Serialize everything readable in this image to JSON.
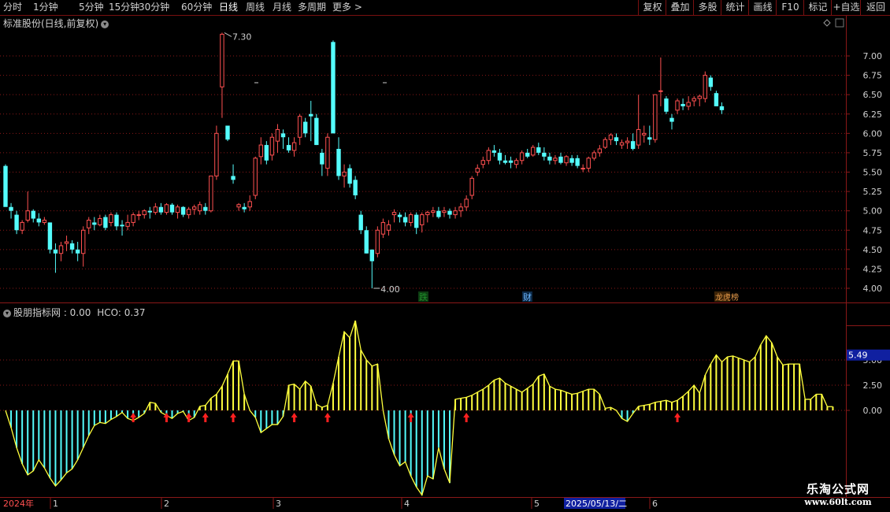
{
  "toolbar": {
    "periods": [
      "分时",
      "1分钟",
      "5分钟",
      "15分钟",
      "30分钟",
      "60分钟",
      "日线",
      "周线",
      "月线",
      "多周期",
      "更多 >"
    ],
    "active": "日线",
    "right_buttons": [
      "复权",
      "叠加",
      "多股",
      "统计",
      "画线",
      "F10",
      "标记",
      "+自选",
      "返回"
    ]
  },
  "price_panel": {
    "title": "标准股份(日线,前复权)",
    "high_label": "7.30",
    "low_label": "4.00",
    "yticks": [
      "7.00",
      "6.75",
      "6.50",
      "6.25",
      "6.00",
      "5.75",
      "5.50",
      "5.25",
      "5.00",
      "4.75",
      "4.50",
      "4.25",
      "4.00"
    ],
    "events": [
      {
        "text": "跌",
        "color": "#1f8f2a",
        "bg": "#0d3d12"
      },
      {
        "text": "财",
        "color": "#6fb8ff",
        "bg": "#0c2a48"
      },
      {
        "text": "龙虎榜",
        "color": "#e59a4a",
        "bg": "#3d2408"
      }
    ]
  },
  "indicator_panel": {
    "title": "股朋指标网 : 0.00",
    "hco_label": "HCO: 0.37",
    "yticks": [
      "5.00",
      "2.50",
      "0.00"
    ],
    "current_value": "5.49"
  },
  "time_axis": {
    "labels": [
      "2024年",
      "1",
      "2",
      "3",
      "4",
      "5",
      "2025/05/13/二",
      "6"
    ]
  },
  "watermark": {
    "line1": "乐淘公式网",
    "line2": "www.60lt.com"
  },
  "colors": {
    "up": "#ff5050",
    "down": "#54fcfc",
    "yellow": "#ffff3c",
    "grid": "#8a1818",
    "arrow": "#ff2020"
  },
  "chart_data": {
    "type": "candlestick",
    "candles": [
      [
        5.58,
        5.6,
        5.3,
        5.05
      ],
      [
        5.05,
        5.1,
        4.9,
        5.0
      ],
      [
        4.95,
        5.0,
        4.7,
        4.75
      ],
      [
        4.75,
        4.88,
        4.7,
        4.85
      ],
      [
        4.88,
        5.25,
        4.85,
        5.0
      ],
      [
        5.0,
        5.02,
        4.85,
        4.9
      ],
      [
        4.9,
        4.97,
        4.8,
        4.85
      ],
      [
        4.85,
        4.92,
        4.82,
        4.88
      ],
      [
        4.85,
        4.85,
        4.45,
        4.5
      ],
      [
        4.5,
        4.58,
        4.2,
        4.45
      ],
      [
        4.45,
        4.6,
        4.35,
        4.55
      ],
      [
        4.58,
        4.68,
        4.48,
        4.6
      ],
      [
        4.58,
        4.62,
        4.45,
        4.5
      ],
      [
        4.5,
        4.6,
        4.35,
        4.45
      ],
      [
        4.45,
        4.8,
        4.28,
        4.75
      ],
      [
        4.78,
        4.92,
        4.7,
        4.88
      ],
      [
        4.85,
        4.92,
        4.75,
        4.82
      ],
      [
        4.82,
        4.95,
        4.8,
        4.9
      ],
      [
        4.92,
        4.95,
        4.75,
        4.78
      ],
      [
        4.85,
        4.98,
        4.8,
        4.95
      ],
      [
        4.95,
        4.98,
        4.75,
        4.8
      ],
      [
        4.82,
        4.88,
        4.68,
        4.8
      ],
      [
        4.8,
        4.95,
        4.75,
        4.85
      ],
      [
        4.85,
        4.98,
        4.8,
        4.95
      ],
      [
        4.95,
        5.0,
        4.88,
        4.95
      ],
      [
        4.95,
        5.02,
        4.9,
        5.0
      ],
      [
        5.0,
        5.05,
        4.9,
        4.98
      ],
      [
        4.98,
        5.1,
        4.95,
        5.05
      ],
      [
        5.05,
        5.1,
        4.95,
        4.98
      ],
      [
        4.98,
        5.1,
        4.95,
        5.08
      ],
      [
        5.08,
        5.1,
        4.95,
        4.98
      ],
      [
        4.98,
        5.08,
        4.9,
        5.05
      ],
      [
        5.05,
        5.06,
        4.92,
        4.95
      ],
      [
        4.95,
        5.05,
        4.9,
        5.02
      ],
      [
        5.02,
        5.08,
        4.95,
        5.05
      ],
      [
        5.0,
        5.12,
        4.95,
        5.08
      ],
      [
        5.05,
        5.1,
        4.95,
        5.0
      ],
      [
        5.0,
        5.45,
        4.98,
        5.45
      ],
      [
        5.45,
        6.1,
        5.4,
        6.0
      ],
      [
        6.6,
        7.3,
        6.2,
        7.28
      ],
      [
        6.1,
        6.1,
        5.9,
        5.92
      ],
      [
        5.45,
        5.6,
        5.35,
        5.4
      ],
      [
        5.05,
        5.1,
        5.0,
        5.08
      ],
      [
        5.05,
        5.1,
        4.98,
        5.02
      ],
      [
        5.05,
        5.2,
        5.0,
        5.12
      ],
      [
        5.2,
        5.7,
        5.15,
        5.68
      ],
      [
        5.7,
        5.95,
        5.6,
        5.85
      ],
      [
        5.85,
        5.9,
        5.6,
        5.65
      ],
      [
        5.72,
        6.0,
        5.65,
        5.95
      ],
      [
        5.9,
        6.12,
        5.75,
        6.05
      ],
      [
        6.0,
        6.05,
        5.8,
        5.95
      ],
      [
        5.85,
        5.95,
        5.75,
        5.78
      ],
      [
        5.78,
        5.95,
        5.7,
        5.88
      ],
      [
        5.95,
        6.25,
        5.85,
        6.22
      ],
      [
        6.15,
        6.2,
        5.95,
        6.0
      ],
      [
        6.25,
        6.42,
        5.9,
        6.22
      ],
      [
        6.2,
        6.25,
        5.85,
        5.85
      ],
      [
        5.75,
        5.8,
        5.45,
        5.6
      ],
      [
        5.55,
        6.0,
        5.45,
        5.95
      ],
      [
        7.18,
        7.2,
        6.0,
        6.0
      ],
      [
        5.8,
        5.95,
        5.4,
        5.45
      ],
      [
        5.45,
        5.6,
        5.3,
        5.5
      ],
      [
        5.55,
        5.6,
        5.3,
        5.35
      ],
      [
        5.4,
        5.45,
        5.15,
        5.2
      ],
      [
        4.95,
        5.0,
        4.7,
        4.75
      ],
      [
        4.75,
        4.8,
        4.45,
        4.45
      ],
      [
        4.5,
        4.5,
        4.0,
        4.35
      ],
      [
        4.45,
        4.8,
        4.4,
        4.75
      ],
      [
        4.7,
        4.9,
        4.65,
        4.85
      ],
      [
        4.75,
        4.88,
        4.68,
        4.82
      ],
      [
        4.95,
        5.02,
        4.85,
        4.98
      ],
      [
        4.95,
        4.98,
        4.85,
        4.92
      ],
      [
        4.92,
        4.98,
        4.8,
        4.85
      ],
      [
        4.85,
        4.98,
        4.8,
        4.95
      ],
      [
        4.95,
        4.98,
        4.7,
        4.78
      ],
      [
        4.82,
        4.98,
        4.72,
        4.95
      ],
      [
        4.95,
        5.0,
        4.85,
        4.98
      ],
      [
        4.98,
        5.05,
        4.92,
        5.0
      ],
      [
        5.0,
        5.05,
        4.9,
        4.92
      ],
      [
        4.98,
        5.05,
        4.92,
        5.0
      ],
      [
        5.0,
        5.03,
        4.9,
        4.95
      ],
      [
        4.95,
        5.05,
        4.9,
        5.0
      ],
      [
        5.0,
        5.1,
        4.92,
        5.05
      ],
      [
        5.05,
        5.2,
        5.0,
        5.15
      ],
      [
        5.2,
        5.45,
        5.15,
        5.42
      ],
      [
        5.5,
        5.6,
        5.45,
        5.55
      ],
      [
        5.6,
        5.7,
        5.55,
        5.65
      ],
      [
        5.65,
        5.82,
        5.6,
        5.78
      ],
      [
        5.78,
        5.85,
        5.7,
        5.75
      ],
      [
        5.75,
        5.8,
        5.6,
        5.65
      ],
      [
        5.65,
        5.72,
        5.6,
        5.62
      ],
      [
        5.65,
        5.7,
        5.55,
        5.62
      ],
      [
        5.6,
        5.68,
        5.55,
        5.65
      ],
      [
        5.65,
        5.78,
        5.6,
        5.75
      ],
      [
        5.75,
        5.8,
        5.68,
        5.7
      ],
      [
        5.72,
        5.85,
        5.7,
        5.82
      ],
      [
        5.82,
        5.88,
        5.72,
        5.75
      ],
      [
        5.75,
        5.82,
        5.65,
        5.7
      ],
      [
        5.7,
        5.75,
        5.6,
        5.65
      ],
      [
        5.65,
        5.72,
        5.6,
        5.68
      ],
      [
        5.7,
        5.75,
        5.6,
        5.62
      ],
      [
        5.62,
        5.72,
        5.58,
        5.7
      ],
      [
        5.68,
        5.72,
        5.58,
        5.62
      ],
      [
        5.68,
        5.72,
        5.55,
        5.58
      ],
      [
        5.55,
        5.6,
        5.5,
        5.55
      ],
      [
        5.55,
        5.7,
        5.5,
        5.68
      ],
      [
        5.68,
        5.78,
        5.65,
        5.75
      ],
      [
        5.75,
        5.85,
        5.7,
        5.8
      ],
      [
        5.82,
        5.95,
        5.8,
        5.92
      ],
      [
        5.92,
        6.0,
        5.85,
        5.98
      ],
      [
        5.95,
        6.0,
        5.85,
        5.9
      ],
      [
        5.85,
        5.92,
        5.8,
        5.88
      ],
      [
        5.88,
        5.95,
        5.8,
        5.9
      ],
      [
        5.9,
        6.0,
        5.78,
        5.8
      ],
      [
        5.85,
        6.5,
        5.8,
        6.05
      ],
      [
        5.98,
        6.1,
        5.88,
        6.0
      ],
      [
        5.95,
        6.1,
        5.85,
        5.92
      ],
      [
        5.92,
        6.5,
        5.88,
        6.5
      ],
      [
        6.55,
        6.98,
        6.35,
        6.55
      ],
      [
        6.45,
        6.48,
        6.25,
        6.28
      ],
      [
        6.2,
        6.25,
        6.05,
        6.15
      ],
      [
        6.3,
        6.45,
        6.25,
        6.42
      ],
      [
        6.38,
        6.45,
        6.3,
        6.35
      ],
      [
        6.35,
        6.48,
        6.3,
        6.4
      ],
      [
        6.42,
        6.48,
        6.35,
        6.45
      ],
      [
        6.45,
        6.5,
        6.35,
        6.48
      ],
      [
        6.45,
        6.8,
        6.4,
        6.75
      ],
      [
        6.72,
        6.75,
        6.55,
        6.6
      ],
      [
        6.52,
        6.55,
        6.35,
        6.35
      ],
      [
        6.35,
        6.4,
        6.25,
        6.3
      ]
    ],
    "indicator": [
      0.0,
      -1.7,
      -3.7,
      -5.3,
      -6.4,
      -6.0,
      -4.9,
      -5.7,
      -6.7,
      -7.5,
      -6.9,
      -6.2,
      -5.8,
      -4.9,
      -3.7,
      -2.5,
      -1.5,
      -1.2,
      -1.3,
      -0.9,
      -0.6,
      -0.2,
      -0.8,
      -1.0,
      -0.7,
      -0.3,
      0.8,
      0.7,
      -0.2,
      -0.5,
      -0.8,
      -0.3,
      -0.1,
      -1.0,
      -0.7,
      0.4,
      0.5,
      1.2,
      1.6,
      2.4,
      3.6,
      4.9,
      4.9,
      1.6,
      0.0,
      -0.7,
      -2.2,
      -1.8,
      -1.4,
      -1.4,
      -0.6,
      2.5,
      2.6,
      2.1,
      2.9,
      2.4,
      0.6,
      0.3,
      0.5,
      2.7,
      5.3,
      7.8,
      7.2,
      8.9,
      6.0,
      5.0,
      4.4,
      4.6,
      0.0,
      -2.8,
      -4.4,
      -5.5,
      -5.1,
      -6.5,
      -7.6,
      -8.4,
      -6.5,
      -6.8,
      -3.7,
      -5.8,
      -7.2,
      1.1,
      1.2,
      1.3,
      1.5,
      1.8,
      2.1,
      2.5,
      3.0,
      3.2,
      2.7,
      2.4,
      2.1,
      1.8,
      2.2,
      2.6,
      3.4,
      3.6,
      2.4,
      2.1,
      2.0,
      1.8,
      1.6,
      1.7,
      1.9,
      2.1,
      2.1,
      1.6,
      0.2,
      0.3,
      0.0,
      -0.8,
      -1.1,
      -0.3,
      0.4,
      0.5,
      0.6,
      0.8,
      0.9,
      1.0,
      0.8,
      1.0,
      1.4,
      1.9,
      2.5,
      1.7,
      3.5,
      4.6,
      5.5,
      4.8,
      5.3,
      5.4,
      5.2,
      5.0,
      4.8,
      5.3,
      6.5,
      7.4,
      6.7,
      5.3,
      4.5,
      4.6,
      4.6,
      4.6,
      1.1,
      1.1,
      1.6,
      1.6,
      0.37,
      0.37
    ],
    "signals": [
      23,
      29,
      33,
      36,
      41,
      52,
      58,
      73,
      83,
      121
    ],
    "ylim_price": [
      3.95,
      7.35
    ],
    "ylim_indicator": [
      -8.6,
      9.0
    ]
  }
}
